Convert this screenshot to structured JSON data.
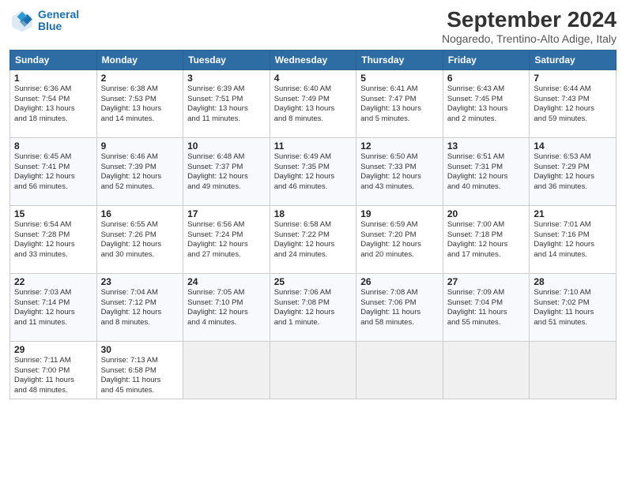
{
  "logo": {
    "line1": "General",
    "line2": "Blue"
  },
  "title": "September 2024",
  "subtitle": "Nogaredo, Trentino-Alto Adige, Italy",
  "days_header": [
    "Sunday",
    "Monday",
    "Tuesday",
    "Wednesday",
    "Thursday",
    "Friday",
    "Saturday"
  ],
  "weeks": [
    [
      {
        "day": "1",
        "info": "Sunrise: 6:36 AM\nSunset: 7:54 PM\nDaylight: 13 hours\nand 18 minutes."
      },
      {
        "day": "2",
        "info": "Sunrise: 6:38 AM\nSunset: 7:53 PM\nDaylight: 13 hours\nand 14 minutes."
      },
      {
        "day": "3",
        "info": "Sunrise: 6:39 AM\nSunset: 7:51 PM\nDaylight: 13 hours\nand 11 minutes."
      },
      {
        "day": "4",
        "info": "Sunrise: 6:40 AM\nSunset: 7:49 PM\nDaylight: 13 hours\nand 8 minutes."
      },
      {
        "day": "5",
        "info": "Sunrise: 6:41 AM\nSunset: 7:47 PM\nDaylight: 13 hours\nand 5 minutes."
      },
      {
        "day": "6",
        "info": "Sunrise: 6:43 AM\nSunset: 7:45 PM\nDaylight: 13 hours\nand 2 minutes."
      },
      {
        "day": "7",
        "info": "Sunrise: 6:44 AM\nSunset: 7:43 PM\nDaylight: 12 hours\nand 59 minutes."
      }
    ],
    [
      {
        "day": "8",
        "info": "Sunrise: 6:45 AM\nSunset: 7:41 PM\nDaylight: 12 hours\nand 56 minutes."
      },
      {
        "day": "9",
        "info": "Sunrise: 6:46 AM\nSunset: 7:39 PM\nDaylight: 12 hours\nand 52 minutes."
      },
      {
        "day": "10",
        "info": "Sunrise: 6:48 AM\nSunset: 7:37 PM\nDaylight: 12 hours\nand 49 minutes."
      },
      {
        "day": "11",
        "info": "Sunrise: 6:49 AM\nSunset: 7:35 PM\nDaylight: 12 hours\nand 46 minutes."
      },
      {
        "day": "12",
        "info": "Sunrise: 6:50 AM\nSunset: 7:33 PM\nDaylight: 12 hours\nand 43 minutes."
      },
      {
        "day": "13",
        "info": "Sunrise: 6:51 AM\nSunset: 7:31 PM\nDaylight: 12 hours\nand 40 minutes."
      },
      {
        "day": "14",
        "info": "Sunrise: 6:53 AM\nSunset: 7:29 PM\nDaylight: 12 hours\nand 36 minutes."
      }
    ],
    [
      {
        "day": "15",
        "info": "Sunrise: 6:54 AM\nSunset: 7:28 PM\nDaylight: 12 hours\nand 33 minutes."
      },
      {
        "day": "16",
        "info": "Sunrise: 6:55 AM\nSunset: 7:26 PM\nDaylight: 12 hours\nand 30 minutes."
      },
      {
        "day": "17",
        "info": "Sunrise: 6:56 AM\nSunset: 7:24 PM\nDaylight: 12 hours\nand 27 minutes."
      },
      {
        "day": "18",
        "info": "Sunrise: 6:58 AM\nSunset: 7:22 PM\nDaylight: 12 hours\nand 24 minutes."
      },
      {
        "day": "19",
        "info": "Sunrise: 6:59 AM\nSunset: 7:20 PM\nDaylight: 12 hours\nand 20 minutes."
      },
      {
        "day": "20",
        "info": "Sunrise: 7:00 AM\nSunset: 7:18 PM\nDaylight: 12 hours\nand 17 minutes."
      },
      {
        "day": "21",
        "info": "Sunrise: 7:01 AM\nSunset: 7:16 PM\nDaylight: 12 hours\nand 14 minutes."
      }
    ],
    [
      {
        "day": "22",
        "info": "Sunrise: 7:03 AM\nSunset: 7:14 PM\nDaylight: 12 hours\nand 11 minutes."
      },
      {
        "day": "23",
        "info": "Sunrise: 7:04 AM\nSunset: 7:12 PM\nDaylight: 12 hours\nand 8 minutes."
      },
      {
        "day": "24",
        "info": "Sunrise: 7:05 AM\nSunset: 7:10 PM\nDaylight: 12 hours\nand 4 minutes."
      },
      {
        "day": "25",
        "info": "Sunrise: 7:06 AM\nSunset: 7:08 PM\nDaylight: 12 hours\nand 1 minute."
      },
      {
        "day": "26",
        "info": "Sunrise: 7:08 AM\nSunset: 7:06 PM\nDaylight: 11 hours\nand 58 minutes."
      },
      {
        "day": "27",
        "info": "Sunrise: 7:09 AM\nSunset: 7:04 PM\nDaylight: 11 hours\nand 55 minutes."
      },
      {
        "day": "28",
        "info": "Sunrise: 7:10 AM\nSunset: 7:02 PM\nDaylight: 11 hours\nand 51 minutes."
      }
    ],
    [
      {
        "day": "29",
        "info": "Sunrise: 7:11 AM\nSunset: 7:00 PM\nDaylight: 11 hours\nand 48 minutes."
      },
      {
        "day": "30",
        "info": "Sunrise: 7:13 AM\nSunset: 6:58 PM\nDaylight: 11 hours\nand 45 minutes."
      },
      {
        "day": "",
        "info": ""
      },
      {
        "day": "",
        "info": ""
      },
      {
        "day": "",
        "info": ""
      },
      {
        "day": "",
        "info": ""
      },
      {
        "day": "",
        "info": ""
      }
    ]
  ]
}
